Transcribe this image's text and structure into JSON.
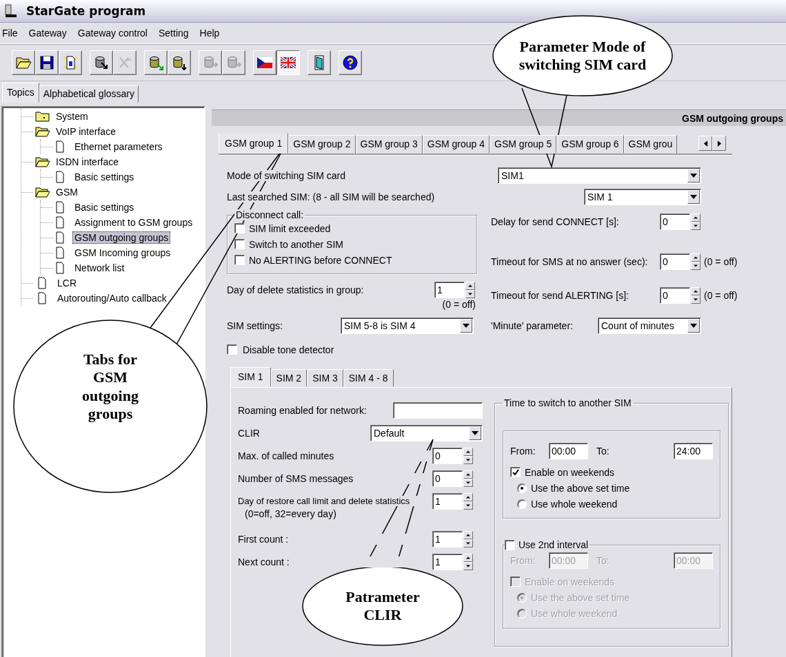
{
  "window": {
    "title": "StarGate program"
  },
  "menu": [
    "File",
    "Gateway",
    "Gateway control",
    "Setting",
    "Help"
  ],
  "toolbar": [
    [
      {
        "kind": "open",
        "disabled": false,
        "selected": false
      },
      {
        "kind": "save",
        "disabled": false,
        "selected": false
      },
      {
        "kind": "file",
        "disabled": false,
        "selected": false
      }
    ],
    [
      {
        "kind": "db-arrow",
        "disabled": false,
        "selected": false
      },
      {
        "kind": "db-cross",
        "disabled": true,
        "selected": false
      }
    ],
    [
      {
        "kind": "db-connect",
        "disabled": false,
        "selected": false
      },
      {
        "kind": "db-down",
        "disabled": false,
        "selected": false
      }
    ],
    [
      {
        "kind": "send",
        "disabled": true,
        "selected": false
      },
      {
        "kind": "receive",
        "disabled": true,
        "selected": false
      }
    ],
    [
      {
        "kind": "flag-cz",
        "disabled": false,
        "selected": false
      },
      {
        "kind": "flag-uk",
        "disabled": false,
        "selected": true
      }
    ],
    [
      {
        "kind": "exit",
        "disabled": false,
        "selected": false
      }
    ],
    [
      {
        "kind": "help",
        "disabled": false,
        "selected": false
      }
    ]
  ],
  "nav_tabs": [
    {
      "label": "Topics",
      "selected": true
    },
    {
      "label": "Alphabetical glossary",
      "selected": false
    }
  ],
  "tree": [
    {
      "label": "System",
      "kind": "folder",
      "expanded": false,
      "selected": false
    },
    {
      "label": "VoIP interface",
      "kind": "folder",
      "expanded": true,
      "selected": false,
      "children": [
        {
          "label": "Ethernet parameters",
          "kind": "page",
          "selected": false
        }
      ]
    },
    {
      "label": "ISDN interface",
      "kind": "folder",
      "expanded": true,
      "selected": false,
      "children": [
        {
          "label": "Basic settings",
          "kind": "page",
          "selected": false
        }
      ]
    },
    {
      "label": "GSM",
      "kind": "folder",
      "expanded": true,
      "selected": false,
      "children": [
        {
          "label": "Basic settings",
          "kind": "page",
          "selected": false
        },
        {
          "label": "Assignment to GSM groups",
          "kind": "page",
          "selected": false
        },
        {
          "label": "GSM outgoing groups",
          "kind": "page",
          "selected": true
        },
        {
          "label": "GSM Incoming groups",
          "kind": "page",
          "selected": false
        },
        {
          "label": "Network list",
          "kind": "page",
          "selected": false
        }
      ]
    },
    {
      "label": "LCR",
      "kind": "page",
      "selected": false
    },
    {
      "label": "Autorouting/Auto callback",
      "kind": "page",
      "selected": false
    }
  ],
  "panel": {
    "title": "GSM outgoing groups"
  },
  "group_tabs": [
    {
      "label": "GSM group 1",
      "selected": true
    },
    {
      "label": "GSM group 2",
      "selected": false
    },
    {
      "label": "GSM group 3",
      "selected": false
    },
    {
      "label": "GSM group 4",
      "selected": false
    },
    {
      "label": "GSM group 5",
      "selected": false
    },
    {
      "label": "GSM group 6",
      "selected": false
    },
    {
      "label": "GSM grou",
      "selected": false
    }
  ],
  "group_form": {
    "mode": {
      "label": "Mode of switching SIM card",
      "value": "SIM1"
    },
    "last_searched": {
      "label": "Last searched SIM: (8 - all SIM will be searched)",
      "value": "SIM 1"
    },
    "disconnect": {
      "legend": "Disconnect call:",
      "options": [
        {
          "label": "SIM limit exceeded",
          "checked": false
        },
        {
          "label": "Switch to another SIM",
          "checked": false
        },
        {
          "label": "No ALERTING before CONNECT",
          "checked": false
        }
      ]
    },
    "connect_delay": {
      "label": "Delay for send CONNECT [s]:",
      "value": "0"
    },
    "sms_timeout": {
      "label": "Timeout for SMS at no answer (sec):",
      "value": "0",
      "note": "(0 = off)"
    },
    "delete_day": {
      "label": "Day of delete statistics in group:",
      "value": "1",
      "note": "(0 = off)"
    },
    "alerting_timeout": {
      "label": "Timeout for send ALERTING [s]:",
      "value": "0",
      "note": "(0 = off)"
    },
    "sim_settings": {
      "label": "SIM settings:",
      "value": "SIM 5-8 is SIM 4"
    },
    "minute": {
      "label": "'Minute' parameter:",
      "value": "Count of minutes"
    },
    "tone_detector": {
      "label": "Disable tone detector",
      "checked": false
    }
  },
  "sim_tabs": [
    {
      "label": "SIM 1",
      "selected": true
    },
    {
      "label": "SIM 2",
      "selected": false
    },
    {
      "label": "SIM 3",
      "selected": false
    },
    {
      "label": "SIM 4 - 8",
      "selected": false
    }
  ],
  "sim_form": {
    "roaming": {
      "label": "Roaming enabled for network:"
    },
    "clir": {
      "label": "CLIR",
      "value": "Default"
    },
    "max_minutes": {
      "label": "Max. of called minutes",
      "value": "0"
    },
    "sms_count": {
      "label": "Number of SMS messages",
      "value": "0"
    },
    "restore_day": {
      "label": "Day of restore call limit and delete statistics",
      "note": "(0=off, 32=every day)",
      "value": "1"
    },
    "first_count": {
      "label": "First count :",
      "value": "1"
    },
    "next_count": {
      "label": "Next count :",
      "value": "1"
    }
  },
  "switch_time": {
    "legend": "Time to switch to another SIM",
    "interval": {
      "disabled": false,
      "from_label": "From:",
      "from": "00:00",
      "to_label": "To:",
      "to": "24:00",
      "weekends": {
        "label": "Enable on weekends",
        "checked": true
      },
      "options": [
        {
          "label": "Use the above set time",
          "selected": true
        },
        {
          "label": "Use whole weekend",
          "selected": false
        }
      ]
    },
    "second_interval": {
      "label": "Use 2nd interval",
      "checked": false,
      "disabled": true,
      "from_label": "From:",
      "from": "00:00",
      "to_label": "To:",
      "to": "00:00",
      "weekends": {
        "label": "Enable on weekends",
        "checked": false
      },
      "options": [
        {
          "label": "Use the above set time",
          "selected": true
        },
        {
          "label": "Use whole weekend",
          "selected": false
        }
      ]
    }
  },
  "callouts": [
    {
      "text": "Parameter Mode of switching SIM card"
    },
    {
      "text": "Tabs for GSM outgoing groups"
    },
    {
      "text": "Patrameter CLIR"
    }
  ]
}
